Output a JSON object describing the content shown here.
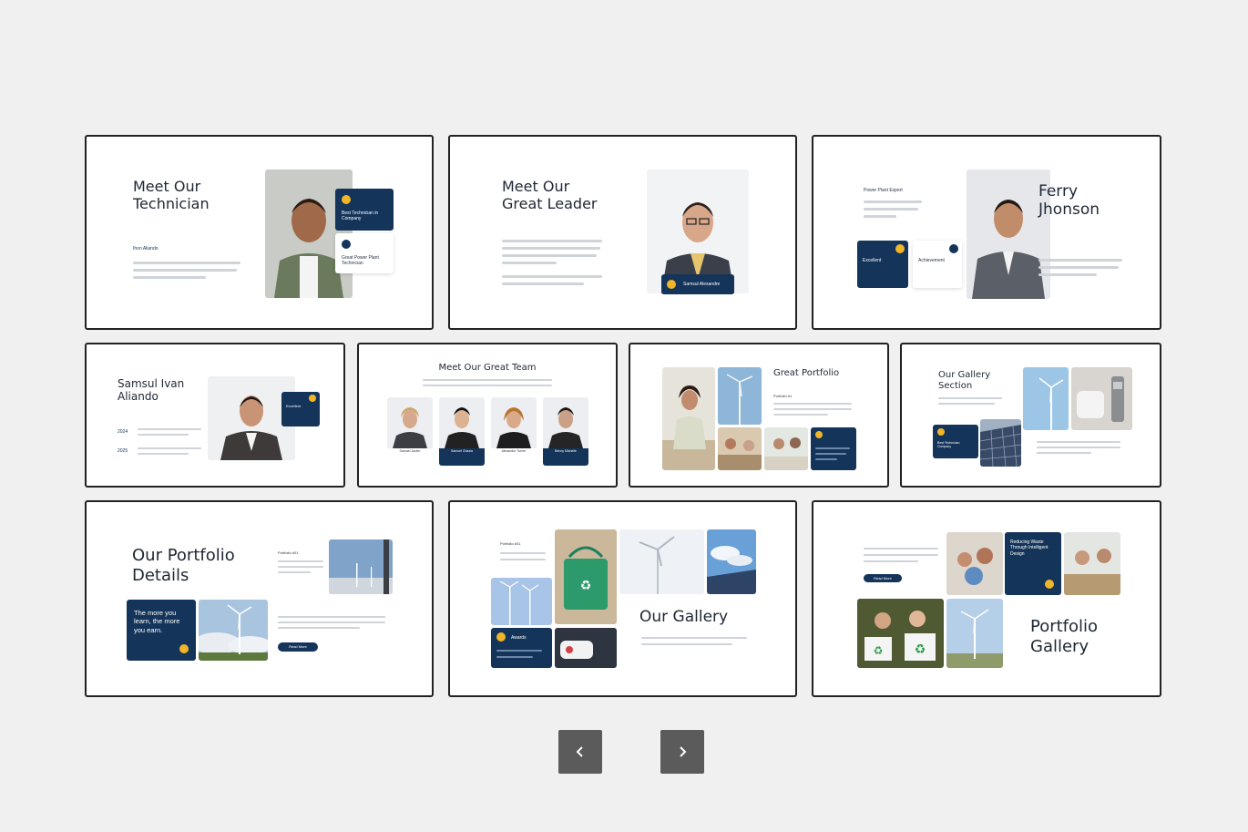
{
  "slides": {
    "s1": {
      "title": "Meet Our\nTechnician",
      "name": "Ihon Aliando",
      "card1": "Best Technician in\nCompany",
      "card2": "Great Power Plant\nTechnician"
    },
    "s2": {
      "title": "Meet Our\nGreat Leader",
      "name_tag": "Samsul Alexandre"
    },
    "s3": {
      "kicker": "Power Plant Expert",
      "title": "Ferry\nJhonson",
      "box1": "Excellent",
      "box2": "Achievement"
    },
    "s4": {
      "title": "Samsul Ivan\nAliando",
      "year1": "2024",
      "year2": "2025",
      "box": "Excellent"
    },
    "s5": {
      "title": "Meet Our Great Team",
      "members": [
        "Samuel Jaclen",
        "Samuel Ghazia",
        "Alexander Turner",
        "Benny Michelle"
      ]
    },
    "s6": {
      "title": "Great Portfolio",
      "sub": "Portfolio #1"
    },
    "s7": {
      "title": "Our Gallery\nSection",
      "box": "Best Technician\nCompany"
    },
    "s8": {
      "title": "Our Portfolio\nDetails",
      "sub": "Portfolio #01",
      "quote": "The more you\nlearn, the more\nyou earn.",
      "button": "Read More"
    },
    "s9": {
      "sub": "Portfolio #01",
      "title": "Our Gallery",
      "box": "Awards"
    },
    "s10": {
      "title": "Portfolio\nGallery",
      "button": "Read More",
      "box": "Reducing Waste\nThrough Intelligent\nDesign"
    }
  },
  "nav": {
    "prev_icon": "chevron-left-icon",
    "next_icon": "chevron-right-icon"
  },
  "colors": {
    "navy": "#14345a",
    "accent": "#f1b52a",
    "nav_button": "#5b5b5b"
  }
}
